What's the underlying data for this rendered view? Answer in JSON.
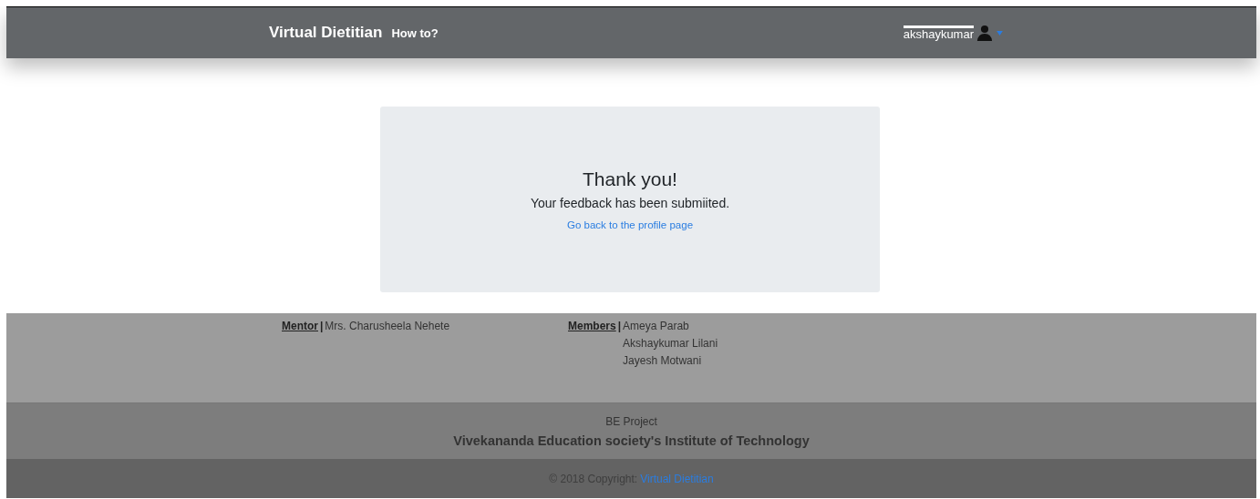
{
  "navbar": {
    "brand": "Virtual Dietitian",
    "links": [
      "How to?"
    ],
    "user": "akshaykumar"
  },
  "message": {
    "title": "Thank you!",
    "text": "Your feedback has been submiited.",
    "link": "Go back to the profile page"
  },
  "footer": {
    "separator": "|",
    "mentor_label": "Mentor",
    "mentor": "Mrs. Charusheela Nehete",
    "members_label": "Members",
    "members": [
      "Ameya Parab",
      "Akshaykumar Lilani",
      "Jayesh Motwani"
    ],
    "project": "BE Project",
    "institute": "Vivekananda Education society's Institute of Technology",
    "copyright": "© 2018 Copyright:",
    "copyright_link": "Virtual Dietitian"
  }
}
